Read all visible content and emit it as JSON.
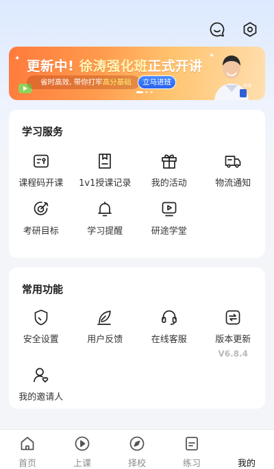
{
  "header": {
    "icons": [
      "message-icon",
      "settings-icon"
    ]
  },
  "banner": {
    "headline_prefix": "更新中!",
    "headline_name": "徐涛强化班",
    "headline_suffix": "正式开讲",
    "sub_text": "省时高效, 带你打牢",
    "sub_highlight": "高分基础",
    "cta": "立马进班",
    "badge_text": "徐涛"
  },
  "study_services": {
    "title": "学习服务",
    "items": [
      {
        "label": "课程码开课",
        "icon": "course-code-icon"
      },
      {
        "label": "1v1授课记录",
        "icon": "document-icon"
      },
      {
        "label": "我的活动",
        "icon": "gift-icon"
      },
      {
        "label": "物流通知",
        "icon": "truck-icon"
      },
      {
        "label": "考研目标",
        "icon": "target-icon"
      },
      {
        "label": "学习提醒",
        "icon": "bell-icon"
      },
      {
        "label": "研途学堂",
        "icon": "video-icon"
      }
    ]
  },
  "common_functions": {
    "title": "常用功能",
    "items": [
      {
        "label": "安全设置",
        "icon": "shield-icon"
      },
      {
        "label": "用户反馈",
        "icon": "feather-icon"
      },
      {
        "label": "在线客服",
        "icon": "headset-icon"
      },
      {
        "label": "版本更新",
        "icon": "update-icon",
        "sub": "V6.8.4"
      },
      {
        "label": "我的邀请人",
        "icon": "inviter-icon"
      }
    ]
  },
  "tabbar": {
    "tabs": [
      {
        "label": "首页",
        "icon": "home-icon"
      },
      {
        "label": "上课",
        "icon": "play-icon"
      },
      {
        "label": "择校",
        "icon": "compass-icon"
      },
      {
        "label": "练习",
        "icon": "exercise-icon"
      },
      {
        "label": "我的",
        "icon": "",
        "active": true
      }
    ]
  },
  "colors": {
    "accent": "#2a62ef",
    "banner_orange": "#ff8a44",
    "icon_stroke": "#222222"
  }
}
